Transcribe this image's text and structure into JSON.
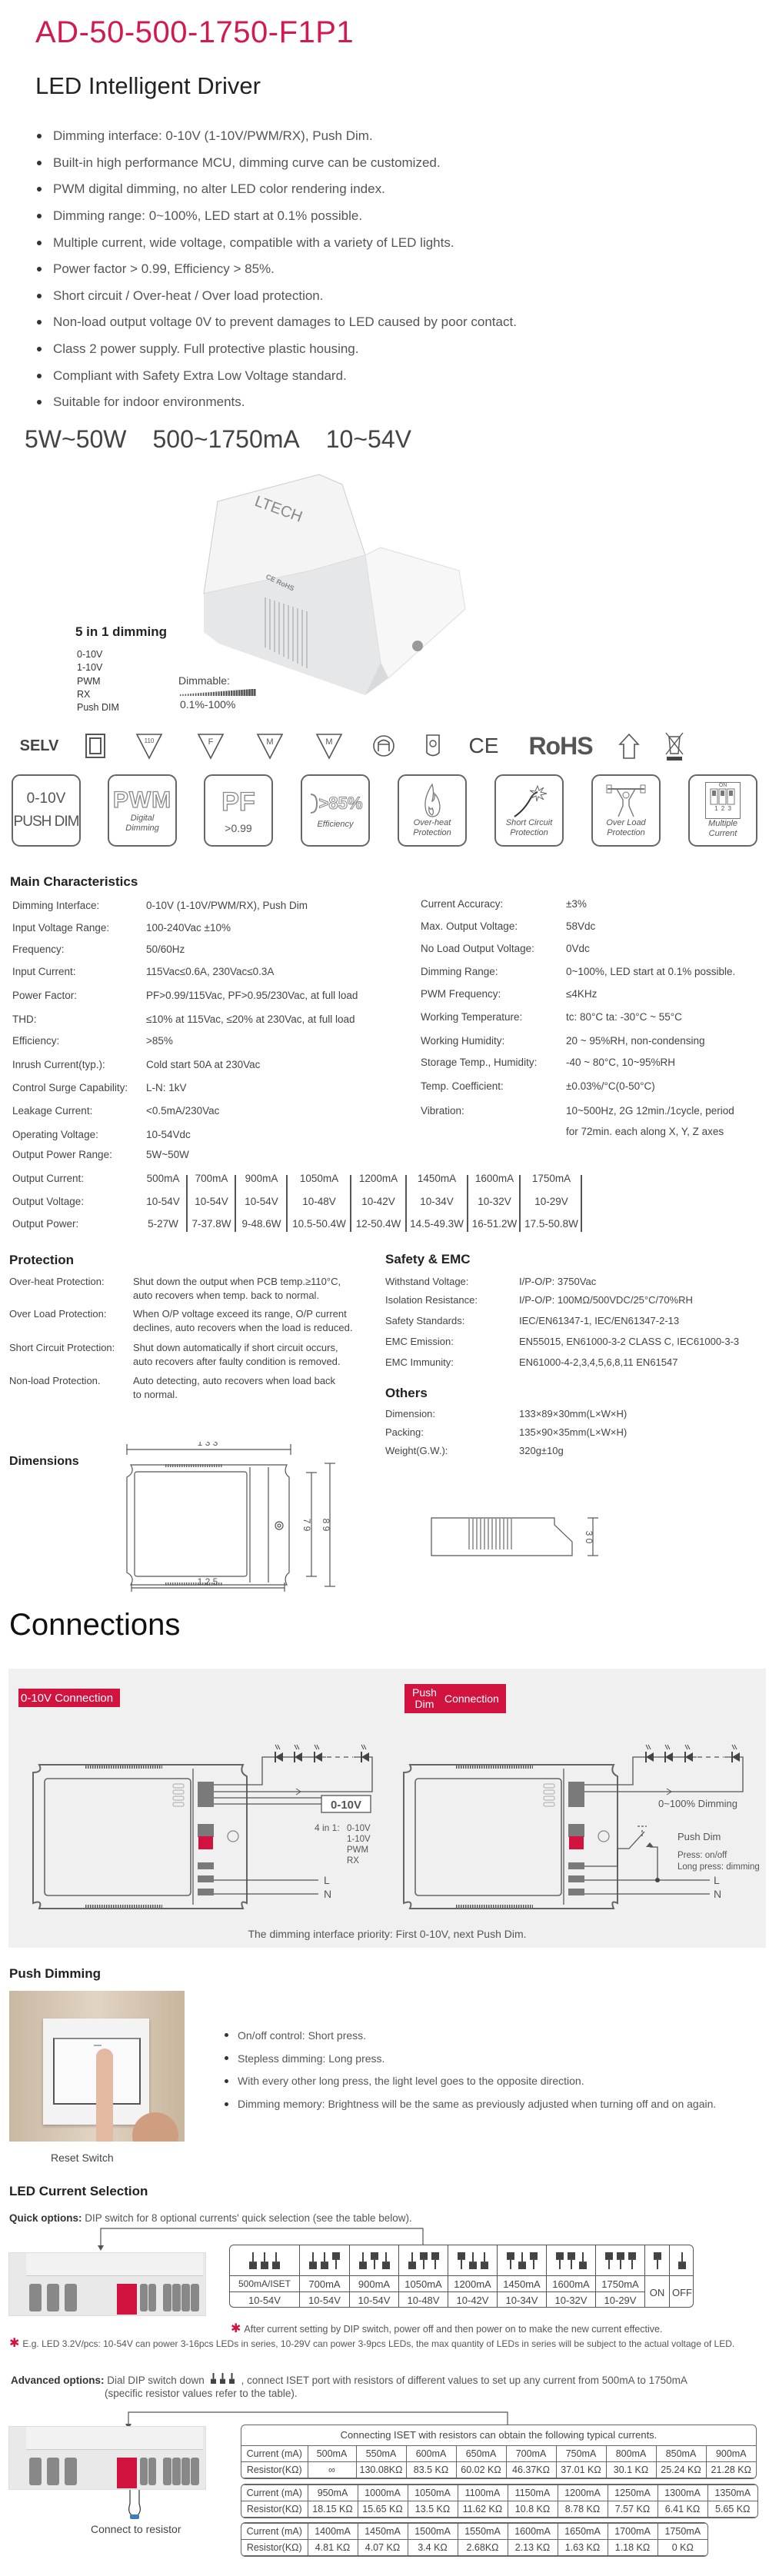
{
  "header": {
    "model": "AD-50-500-1750-F1P1",
    "subtitle": "LED Intelligent Driver"
  },
  "features": [
    "Dimming interface: 0-10V (1-10V/PWM/RX), Push Dim.",
    "Built-in high performance MCU, dimming curve can be customized.",
    "PWM digital dimming, no alter LED color rendering index.",
    "Dimming range: 0~100%, LED start at 0.1% possible.",
    "Multiple current, wide voltage, compatible with a variety of LED lights.",
    "Power factor > 0.99, Efficiency > 85%.",
    "Short circuit / Over-heat / Over load protection.",
    "Non-load output voltage 0V to prevent damages to LED caused by poor contact.",
    "Class 2 power supply. Full protective plastic housing.",
    "Compliant with Safety Extra Low Voltage standard.",
    "Suitable for indoor environments."
  ],
  "banner": [
    "5W~50W",
    "500~1750mA",
    "10~54V"
  ],
  "product": {
    "brand": "LTECH",
    "dimming_title": "5 in 1 dimming",
    "modes": [
      "0-10V",
      "1-10V",
      "PWM",
      "RX",
      "Push DIM"
    ],
    "dimmable_label": "Dimmable:",
    "dimmable_range": "0.1%-100%"
  },
  "certifications": {
    "selv": "SELV",
    "tri_110": "110",
    "tri_f": "F",
    "tri_m1": "M",
    "tri_m2": "M",
    "ce": "CE",
    "rohs": "RoHS",
    "icons": [
      "double-insulation-icon",
      "triangle-110-icon",
      "triangle-f-icon",
      "triangle-m-icon",
      "triangle-m-icon",
      "independent-control-gear-icon",
      "lamp-icon",
      "ce-mark-icon",
      "rohs-icon",
      "indoor-use-icon",
      "weee-bin-icon"
    ]
  },
  "feature_tiles": {
    "t1_line1": "0-10V",
    "t1_line2": "PUSH DIM",
    "t2_big": "PWM",
    "t2_cap1": "Digital",
    "t2_cap2": "Dimming",
    "t3_big": "PF",
    "t3_cap": ">0.99",
    "t4_big": ">85%",
    "t4_cap": "Efficiency",
    "t5_cap1": "Over-heat",
    "t5_cap2": "Protection",
    "t6_cap1": "Short Circuit",
    "t6_cap2": "Protection",
    "t7_cap1": "Over Load",
    "t7_cap2": "Protection",
    "t8_on": "ON",
    "t8_nums": "1 2 3",
    "t8_cap1": "Multiple",
    "t8_cap2": "Current"
  },
  "main": {
    "title": "Main Characteristics",
    "left": [
      {
        "label": "Dimming Interface:",
        "value": "0-10V (1-10V/PWM/RX), Push Dim"
      },
      {
        "label": "Input Voltage Range:",
        "value": "100-240Vac  ±10%"
      },
      {
        "label": "Frequency:",
        "value": "50/60Hz"
      },
      {
        "label": "Input Current:",
        "value": "115Vac≤0.6A, 230Vac≤0.3A"
      },
      {
        "label": "Power Factor:",
        "value": "PF>0.99/115Vac, PF>0.95/230Vac, at full load"
      },
      {
        "label": "THD:",
        "value": "≤10% at 115Vac, ≤20% at 230Vac, at full load"
      },
      {
        "label": "Efficiency:",
        "value": ">85%"
      },
      {
        "label": "Inrush Current(typ.):",
        "value": "Cold start 50A at 230Vac"
      },
      {
        "label": "Control Surge Capability:",
        "value": "L-N: 1kV"
      },
      {
        "label": "Leakage Current:",
        "value": "<0.5mA/230Vac"
      },
      {
        "label": "Operating Voltage:",
        "value": "10-54Vdc"
      },
      {
        "label": "Output Power Range:",
        "value": "5W~50W"
      }
    ],
    "right": [
      {
        "label": "Current Accuracy:",
        "value": "±3%"
      },
      {
        "label": "Max. Output Voltage:",
        "value": "58Vdc"
      },
      {
        "label": "No Load Output Voltage:",
        "value": "0Vdc"
      },
      {
        "label": "Dimming Range:",
        "value": "0~100%, LED start at 0.1% possible."
      },
      {
        "label": "PWM Frequency:",
        "value": "≤4KHz"
      },
      {
        "label": "Working Temperature:",
        "value": "tc: 80°C     ta: -30°C ~ 55°C"
      },
      {
        "label": "Working Humidity:",
        "value": "20 ~ 95%RH, non-condensing"
      },
      {
        "label": "Storage Temp., Humidity:",
        "value": "-40 ~ 80°C, 10~95%RH"
      },
      {
        "label": "Temp. Coefficient:",
        "value": "±0.03%/°C(0-50°C)"
      },
      {
        "label": "Vibration:",
        "value": "10~500Hz, 2G 12min./1cycle, period",
        "value2": "for 72min. each along X, Y, Z axes"
      }
    ],
    "output_table": {
      "labels": [
        "Output Current:",
        "Output Voltage:",
        "Output Power:"
      ],
      "columns": [
        {
          "current": "500mA",
          "voltage": "10-54V",
          "power": "5-27W"
        },
        {
          "current": "700mA",
          "voltage": "10-54V",
          "power": "7-37.8W"
        },
        {
          "current": "900mA",
          "voltage": "10-54V",
          "power": "9-48.6W"
        },
        {
          "current": "1050mA",
          "voltage": "10-48V",
          "power": "10.5-50.4W"
        },
        {
          "current": "1200mA",
          "voltage": "10-42V",
          "power": "12-50.4W"
        },
        {
          "current": "1450mA",
          "voltage": "10-34V",
          "power": "14.5-49.3W"
        },
        {
          "current": "1600mA",
          "voltage": "10-32V",
          "power": "16-51.2W"
        },
        {
          "current": "1750mA",
          "voltage": "10-29V",
          "power": "17.5-50.8W"
        }
      ]
    }
  },
  "protection": {
    "title": "Protection",
    "rows": [
      {
        "label": "Over-heat Protection:",
        "lines": [
          "Shut down the output when PCB temp.≥110°C,",
          "auto recovers when temp. back to normal."
        ]
      },
      {
        "label": "Over Load Protection:",
        "lines": [
          "When O/P voltage exceed its range, O/P current",
          "declines, auto recovers when the load is reduced."
        ]
      },
      {
        "label": "Short Circuit Protection:",
        "lines": [
          "Shut down automatically if short circuit occurs,",
          "auto recovers after faulty condition is removed."
        ]
      },
      {
        "label": "Non-load Protection.",
        "lines": [
          "Auto detecting, auto recovers when load back",
          "to normal."
        ]
      }
    ]
  },
  "safety": {
    "title": "Safety & EMC",
    "rows": [
      {
        "label": "Withstand Voltage:",
        "value": "I/P-O/P: 3750Vac"
      },
      {
        "label": "Isolation Resistance:",
        "value": "I/P-O/P: 100MΩ/500VDC/25°C/70%RH"
      },
      {
        "label": "Safety Standards:",
        "value": "IEC/EN61347-1, IEC/EN61347-2-13"
      },
      {
        "label": "EMC Emission:",
        "value": "EN55015, EN61000-3-2 CLASS C, IEC61000-3-3"
      },
      {
        "label": "EMC Immunity:",
        "value": "EN61000-4-2,3,4,5,6,8,11  EN61547"
      }
    ]
  },
  "others": {
    "title": "Others",
    "rows": [
      {
        "label": "Dimension:",
        "value": "133×89×30mm(L×W×H)"
      },
      {
        "label": "Packing:",
        "value": "135×90×35mm(L×W×H)"
      },
      {
        "label": "Weight(G.W.):",
        "value": "320g±10g"
      }
    ]
  },
  "dimensions": {
    "title": "Dimensions",
    "length": "1 3 3",
    "inner_length": "1 2 5",
    "inner_width": "7 9",
    "width": "8 9",
    "height": "3 0"
  },
  "connections": {
    "title": "Connections",
    "left_label": "0-10V Connection",
    "right_label_a": "Push",
    "right_label_b": "Dim",
    "right_label_c": "Connection",
    "signal_box": "0-10V",
    "four_in_one": "4 in 1:",
    "four_modes": [
      "0-10V",
      "1-10V",
      "PWM",
      "RX"
    ],
    "line_l": "L",
    "line_n": "N",
    "dimming_range": "0~100% Dimming",
    "push_dim": "Push Dim",
    "press": "Press: on/off",
    "long_press": "Long press: dimming",
    "caption": "The dimming interface priority: First 0-10V, next Push Dim.",
    "accent": "#d2123f"
  },
  "push_dimming": {
    "title": "Push Dimming",
    "bullets": [
      "On/off control: Short press.",
      "Stepless dimming: Long press.",
      "With every other long press, the light level goes to the opposite direction.",
      "Dimming memory: Brightness will be the same as previously adjusted when turning off and on again."
    ],
    "photo_caption": "Reset Switch"
  },
  "current_selection": {
    "title": "LED Current Selection",
    "quick_label": "Quick options:",
    "quick_text": " DIP switch for 8 optional currents' quick selection (see the table below).",
    "dip_table": [
      {
        "pattern": "ddd",
        "current": "500mA/ISET",
        "voltage": "10-54V"
      },
      {
        "pattern": "ddu",
        "current": "700mA",
        "voltage": "10-54V"
      },
      {
        "pattern": "dud",
        "current": "900mA",
        "voltage": "10-54V"
      },
      {
        "pattern": "duu",
        "current": "1050mA",
        "voltage": "10-48V"
      },
      {
        "pattern": "udd",
        "current": "1200mA",
        "voltage": "10-42V"
      },
      {
        "pattern": "udu",
        "current": "1450mA",
        "voltage": "10-34V"
      },
      {
        "pattern": "uud",
        "current": "1600mA",
        "voltage": "10-32V"
      },
      {
        "pattern": "uuu",
        "current": "1750mA",
        "voltage": "10-29V"
      }
    ],
    "legend": [
      {
        "pattern": "u",
        "label": "ON"
      },
      {
        "pattern": "d",
        "label": "OFF"
      }
    ],
    "note1": "After current setting by DIP switch, power off and then power on to make the new current effective.",
    "note2": "E.g. LED 3.2V/pcs: 10-54V can power 3-16pcs LEDs in series, 10-29V can power 3-9pcs LEDs, the max quantity of LEDs in series will be subject to the actual voltage of LED.",
    "advanced_label": "Advanced options:",
    "advanced_text_a": " Dial DIP switch down ",
    "advanced_text_b": ", connect ISET port with resistors of different values to set up any current from 500mA to 1750mA",
    "advanced_text_c": "(specific resistor values refer to the table).",
    "resistor_caption": "Connect to resistor",
    "resistor_table_title": "Connecting ISET with resistors can obtain the following typical currents.",
    "row_current_label": "Current (mA)",
    "row_resistor_label": "Resistor(KΩ)",
    "resistor_tables": [
      {
        "currents": [
          "500mA",
          "550mA",
          "600mA",
          "650mA",
          "700mA",
          "750mA",
          "800mA",
          "850mA",
          "900mA"
        ],
        "resistors": [
          "∞",
          "130.08KΩ",
          "83.5 KΩ",
          "60.02 KΩ",
          "46.37KΩ",
          "37.01 KΩ",
          "30.1 KΩ",
          "25.24 KΩ",
          "21.28 KΩ"
        ]
      },
      {
        "currents": [
          "950mA",
          "1000mA",
          "1050mA",
          "1100mA",
          "1150mA",
          "1200mA",
          "1250mA",
          "1300mA",
          "1350mA"
        ],
        "resistors": [
          "18.15 KΩ",
          "15.65 KΩ",
          "13.5 KΩ",
          "11.62 KΩ",
          "10.8 KΩ",
          "8.78 KΩ",
          "7.57 KΩ",
          "6.41 KΩ",
          "5.65 KΩ"
        ]
      },
      {
        "currents": [
          "1400mA",
          "1450mA",
          "1500mA",
          "1550mA",
          "1600mA",
          "1650mA",
          "1700mA",
          "1750mA"
        ],
        "resistors": [
          "4.81 KΩ",
          "4.07 KΩ",
          "3.4 KΩ",
          "2.68KΩ",
          "2.13 KΩ",
          "1.63 KΩ",
          "1.18 KΩ",
          "0 KΩ"
        ]
      }
    ]
  }
}
